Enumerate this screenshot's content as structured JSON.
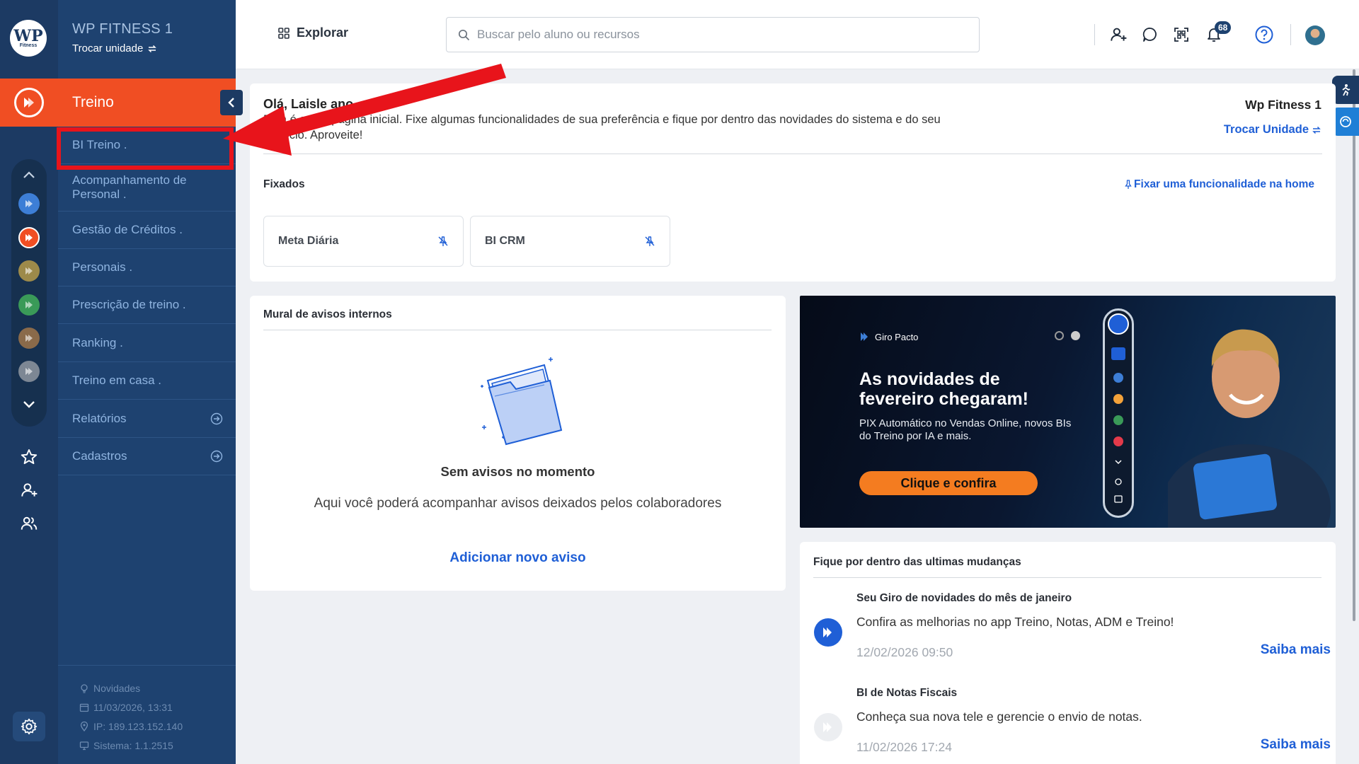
{
  "brand": {
    "logo_text": "WP",
    "logo_sub": "Fitness",
    "unit_name": "WP FITNESS 1",
    "switch_unit": "Trocar unidade"
  },
  "menu": {
    "header": "Treino",
    "items": [
      {
        "label": "BI Treino .",
        "has_arrow": false
      },
      {
        "label": "Acompanhamento de Personal .",
        "has_arrow": false
      },
      {
        "label": "Gestão de Créditos .",
        "has_arrow": false
      },
      {
        "label": "Personais .",
        "has_arrow": false
      },
      {
        "label": "Prescrição de treino .",
        "has_arrow": false
      },
      {
        "label": "Ranking .",
        "has_arrow": false
      },
      {
        "label": "Treino em casa .",
        "has_arrow": false
      },
      {
        "label": "Relatórios",
        "has_arrow": true
      },
      {
        "label": "Cadastros",
        "has_arrow": true
      }
    ],
    "footer": {
      "news": "Novidades",
      "datetime": "11/03/2026, 13:31",
      "ip": "IP: 189.123.152.140",
      "system": "Sistema: 1.1.2515"
    }
  },
  "topbar": {
    "explore": "Explorar",
    "search_placeholder": "Buscar pelo aluno ou recursos",
    "notification_count": "68"
  },
  "welcome": {
    "greeting": "Olá, Laisle",
    "greeting_hidden": "ano",
    "intro": "Esta é a sua página inicial. Fixe algumas funcionalidades de sua preferência e fique por dentro das novidades do sistema e do seu negócio. Aproveite!",
    "unit": "Wp Fitness 1",
    "switch_unit": "Trocar Unidade",
    "pinned_title": "Fixados",
    "pin_link": "Fixar uma funcionalidade na home",
    "pinned": [
      "Meta Diária",
      "BI CRM"
    ]
  },
  "mural": {
    "title": "Mural de avisos internos",
    "empty_title": "Sem avisos no momento",
    "empty_sub": "Aqui você poderá acompanhar avisos deixados pelos colaboradores",
    "add": "Adicionar novo aviso"
  },
  "banner": {
    "brand": "Giro Pacto",
    "title": "As novidades de fevereiro chegaram!",
    "subtitle": "PIX Automático no Vendas Online, novos BIs do Treino por IA e mais.",
    "cta": "Clique e confira"
  },
  "changes": {
    "title": "Fique por dentro das ultimas mudanças",
    "items": [
      {
        "title": "Seu Giro de novidades do mês de janeiro",
        "desc": "Confira as melhorias no app Treino, Notas, ADM e Treino!",
        "date": "12/02/2026 09:50",
        "more": "Saiba mais"
      },
      {
        "title": "BI de Notas Fiscais",
        "desc": "Conheça sua nova tele e gerencie o envio de notas.",
        "date": "11/02/2026 17:24",
        "more": "Saiba mais"
      }
    ]
  },
  "colors": {
    "primary_dark": "#1c3a63",
    "menu_bg": "#1e4270",
    "accent_orange": "#f04e23",
    "link_blue": "#1f5fd6",
    "annotation_red": "#e8141b"
  },
  "icons": [
    "pacto-logo-icon",
    "chevron-up-icon",
    "chevron-down-icon",
    "star-icon",
    "user-plus-icon",
    "users-icon",
    "gear-icon",
    "grid-icon",
    "search-icon",
    "chat-icon",
    "qr-icon",
    "bell-icon",
    "help-icon",
    "pin-off-icon",
    "swap-icon",
    "folder-illustration"
  ]
}
